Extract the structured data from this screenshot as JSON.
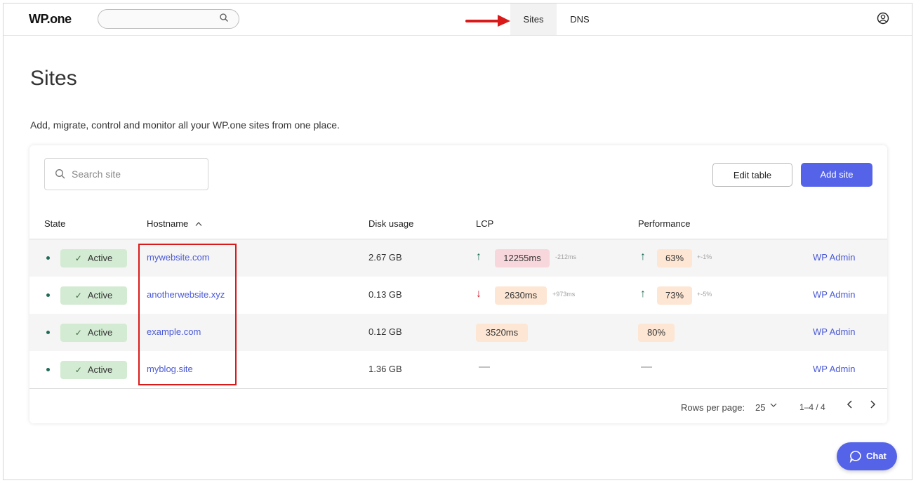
{
  "app": {
    "logo": "WP.one"
  },
  "nav": {
    "tabs": [
      {
        "label": "Sites",
        "active": true
      },
      {
        "label": "DNS",
        "active": false
      }
    ]
  },
  "page": {
    "title": "Sites",
    "subtitle": "Add, migrate, control and monitor all your WP.one sites from one place."
  },
  "toolbar": {
    "search_placeholder": "Search site",
    "edit_table_label": "Edit table",
    "add_site_label": "Add site"
  },
  "table": {
    "columns": [
      "State",
      "Hostname",
      "Disk usage",
      "LCP",
      "Performance"
    ],
    "sort_indicator": "^",
    "rows": [
      {
        "state": "Active",
        "hostname": "mywebsite.com",
        "disk": "2.67 GB",
        "lcp": "12255ms",
        "lcp_delta": "-212ms",
        "lcp_trend": "up",
        "lcp_color": "red",
        "perf": "63%",
        "perf_delta": "+-1%",
        "perf_trend": "up",
        "action": "WP Admin"
      },
      {
        "state": "Active",
        "hostname": "anotherwebsite.xyz",
        "disk": "0.13 GB",
        "lcp": "2630ms",
        "lcp_delta": "+973ms",
        "lcp_trend": "down",
        "lcp_color": "orange",
        "perf": "73%",
        "perf_delta": "+-5%",
        "perf_trend": "up",
        "action": "WP Admin"
      },
      {
        "state": "Active",
        "hostname": "example.com",
        "disk": "0.12 GB",
        "lcp": "3520ms",
        "lcp_delta": "",
        "lcp_trend": "",
        "lcp_color": "orange",
        "perf": "80%",
        "perf_delta": "",
        "perf_trend": "",
        "action": "WP Admin"
      },
      {
        "state": "Active",
        "hostname": "myblog.site",
        "disk": "1.36 GB",
        "lcp": "—",
        "lcp_delta": "",
        "lcp_trend": "",
        "lcp_color": "",
        "perf": "—",
        "perf_delta": "",
        "perf_trend": "",
        "action": "WP Admin"
      }
    ]
  },
  "pagination": {
    "rows_per_page_label": "Rows per page:",
    "rows_per_page_value": "25",
    "range": "1–4 / 4"
  },
  "chat": {
    "label": "Chat"
  },
  "colors": {
    "accent": "#5463e8",
    "active_badge": "#d3ebd2",
    "lcp_bad": "#f7d7dc",
    "lcp_warn": "#fde6d3",
    "annotation": "#d91a1a"
  }
}
